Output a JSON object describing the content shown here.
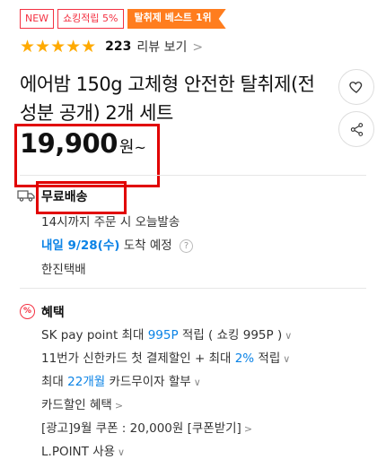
{
  "badges": {
    "new": "NEW",
    "smile": "쇼킹적립 5%",
    "best": "탈취제 베스트 1위"
  },
  "rating": {
    "stars": "★★★★★",
    "count": "223",
    "review_label": "리뷰 보기",
    "chevron": ">"
  },
  "product": {
    "title": "에어밤 150g 고체형 안전한 탈취제(전성분 공개) 2개 세트"
  },
  "price": {
    "amount": "19,900",
    "unit": "원",
    "suffix": "~"
  },
  "shipping": {
    "title": "무료배송",
    "order_note": "14시까지 주문 시 오늘발송",
    "arrival_date": "내일 9/28(수)",
    "arrival_label": "도착 예정",
    "help_icon": "?",
    "carrier": "한진택배"
  },
  "benefits": {
    "icon_label": "%",
    "title": "혜택",
    "sk_prefix": "SK pay point 최대",
    "sk_amount": "995P",
    "sk_mid": "적립 ( 쇼킹 995P )",
    "card_prefix": "11번가 신한카드 첫 결제할인 + 최대",
    "card_rate": "2%",
    "card_suffix": "적립",
    "installment_prefix": "최대",
    "installment_months": "22개월",
    "installment_suffix": "카드무이자 할부",
    "card_discount": "카드할인 혜택",
    "coupon": "[광고]9월 쿠폰 : 20,000원 [쿠폰받기]",
    "lpoint": "L.POINT 사용",
    "chevron_down": "∨",
    "chevron_right": ">"
  },
  "colors": {
    "accent_red": "#f43142",
    "best_orange": "#ff7d1e",
    "star": "#ffaa00",
    "link_blue": "#0b83e6",
    "highlight_box": "#e10000"
  }
}
